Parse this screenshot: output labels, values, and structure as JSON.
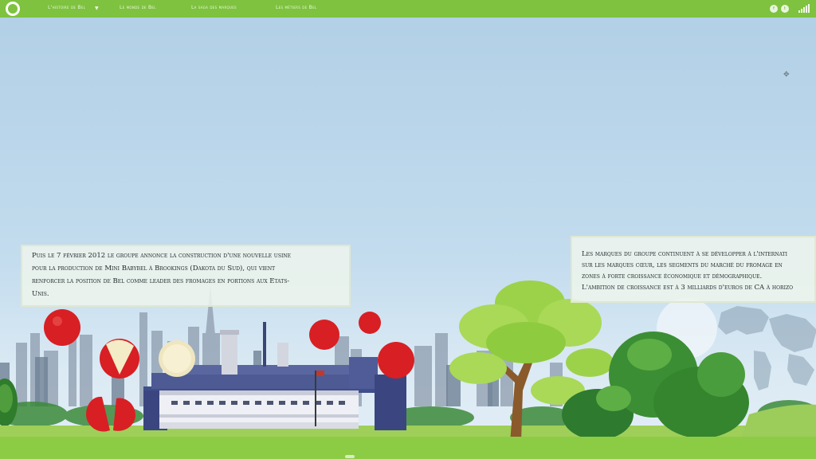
{
  "nav": {
    "items": [
      {
        "label": "L'histoire de Bel",
        "has_dropdown": true
      },
      {
        "label": "Le monde de Bel"
      },
      {
        "label": "La saga des marques"
      },
      {
        "label": "Les métiers de Bel"
      }
    ]
  },
  "top_right": {
    "buttons": [
      "facebook-icon",
      "twitter-icon"
    ],
    "sound_icon": "sound-level-icon"
  },
  "text_left": {
    "lines": [
      "Puis le 7 février 2012 le groupe annonce la construction d'une nouvelle usine",
      "pour la production de Mini Babybel à Brookings (Dakota du Sud), qui vient",
      "renforcer la position de Bel comme leader des fromages en portions aux Etats-",
      "Unis."
    ]
  },
  "text_right": {
    "lines": [
      "Les marques du groupe continuent à se développer à l'internati",
      "sur les marques cœur, les segments du marché du fromage en",
      "zones à forte croissance économique et démographique.",
      "L'ambition de croissance est à 3 milliards d'euros de CA à horizo"
    ]
  },
  "colors": {
    "topbar": "#7ec23f",
    "sky": "#b9d6ea",
    "cheese_red": "#d81f24",
    "ground": "#8ccc45"
  }
}
